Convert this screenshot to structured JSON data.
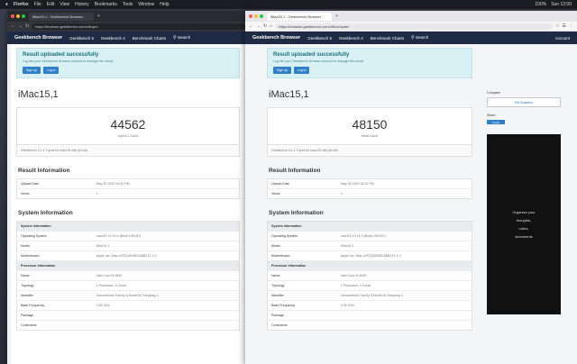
{
  "menubar": {
    "app": "Firefox",
    "items": [
      "File",
      "Edit",
      "View",
      "History",
      "Bookmarks",
      "Tools",
      "Window",
      "Help"
    ],
    "right": [
      "100%",
      "Sun 12:00"
    ]
  },
  "back_window": {
    "tab_title": "iMac15,1 - Geekbench Browser",
    "url": "https://browser.geekbench.com/v5/cpu/",
    "nav": {
      "brand": "Geekbench Browser",
      "links": [
        "Geekbench 5",
        "Geekbench 4",
        "Benchmark Charts"
      ],
      "search": "Search"
    },
    "alert": {
      "title": "Result uploaded successfully",
      "subtitle": "Log into your Geekbench Browser account to manage this result.",
      "signup": "Sign up",
      "login": "Log in"
    },
    "model": "iMac15,1",
    "score": "44562",
    "score_label": "OpenCL Score",
    "note": "Geekbench 5.1.1 Tryout for macOS x86 (64-bit)",
    "result_info_title": "Result Information",
    "result_info": [
      {
        "k": "Upload Date",
        "v": "May 30 2020 04:30 PM"
      },
      {
        "k": "Views",
        "v": "1"
      }
    ],
    "system_info_title": "System Information",
    "system_header": "System Information",
    "system_info": [
      {
        "k": "Operating System",
        "v": "macOS 10.15.4 (Build 19E287)"
      },
      {
        "k": "Model",
        "v": "iMac15,1"
      },
      {
        "k": "Motherboard",
        "v": "Apple Inc. Mac-42FD25EABCABB274 1.0"
      }
    ],
    "processor_header": "Processor Information",
    "processor_info": [
      {
        "k": "Name",
        "v": "Intel Core i5-4690"
      },
      {
        "k": "Topology",
        "v": "1 Processor, 4 Cores"
      },
      {
        "k": "Identifier",
        "v": "GenuineIntel Family 6 Model 60 Stepping 3"
      },
      {
        "k": "Base Frequency",
        "v": "3.50 GHz"
      },
      {
        "k": "Package",
        "v": ""
      },
      {
        "k": "Codename",
        "v": ""
      }
    ]
  },
  "front_window": {
    "tab_title": "iMac15,1 - Geekbench Browser",
    "url": "https://browser.geekbench.com/v5/compute/",
    "nav": {
      "brand": "Geekbench Browser",
      "links": [
        "Geekbench 5",
        "Geekbench 4",
        "Benchmark Charts"
      ],
      "search": "Search",
      "account": "Account"
    },
    "alert": {
      "title": "Result uploaded successfully",
      "subtitle": "Log into your Geekbench Browser account to manage this result.",
      "signup": "Sign up",
      "login": "Log in"
    },
    "model": "iMac15,1",
    "score": "48150",
    "score_label": "Metal Score",
    "note": "Geekbench 5.1.1 Tryout for macOS x86 (64-bit)",
    "result_info_title": "Result Information",
    "result_info": [
      {
        "k": "Upload Date",
        "v": "May 30 2020 04:32 PM"
      },
      {
        "k": "Views",
        "v": "1"
      }
    ],
    "system_info_title": "System Information",
    "system_header": "System Information",
    "system_info": [
      {
        "k": "Operating System",
        "v": "macOS 10.15.4 (Build 19E287)"
      },
      {
        "k": "Model",
        "v": "iMac15,1"
      },
      {
        "k": "Motherboard",
        "v": "Apple Inc. Mac-42FD25EABCABB274 1.0"
      }
    ],
    "processor_header": "Processor Information",
    "processor_info": [
      {
        "k": "Name",
        "v": "Intel Core i5-4690"
      },
      {
        "k": "Topology",
        "v": "1 Processor, 4 Cores"
      },
      {
        "k": "Identifier",
        "v": "GenuineIntel Family 6 Model 60 Stepping 3"
      },
      {
        "k": "Base Frequency",
        "v": "3.50 GHz"
      },
      {
        "k": "Package",
        "v": ""
      },
      {
        "k": "Codename",
        "v": ""
      }
    ],
    "sidebar": {
      "compare_label": "Compare",
      "set_baseline": "Set Baseline",
      "share_label": "Share",
      "share_button": "Tweet",
      "ad_lines": [
        "Organize your",
        "thoughts,",
        "notes,",
        "documents"
      ]
    }
  }
}
